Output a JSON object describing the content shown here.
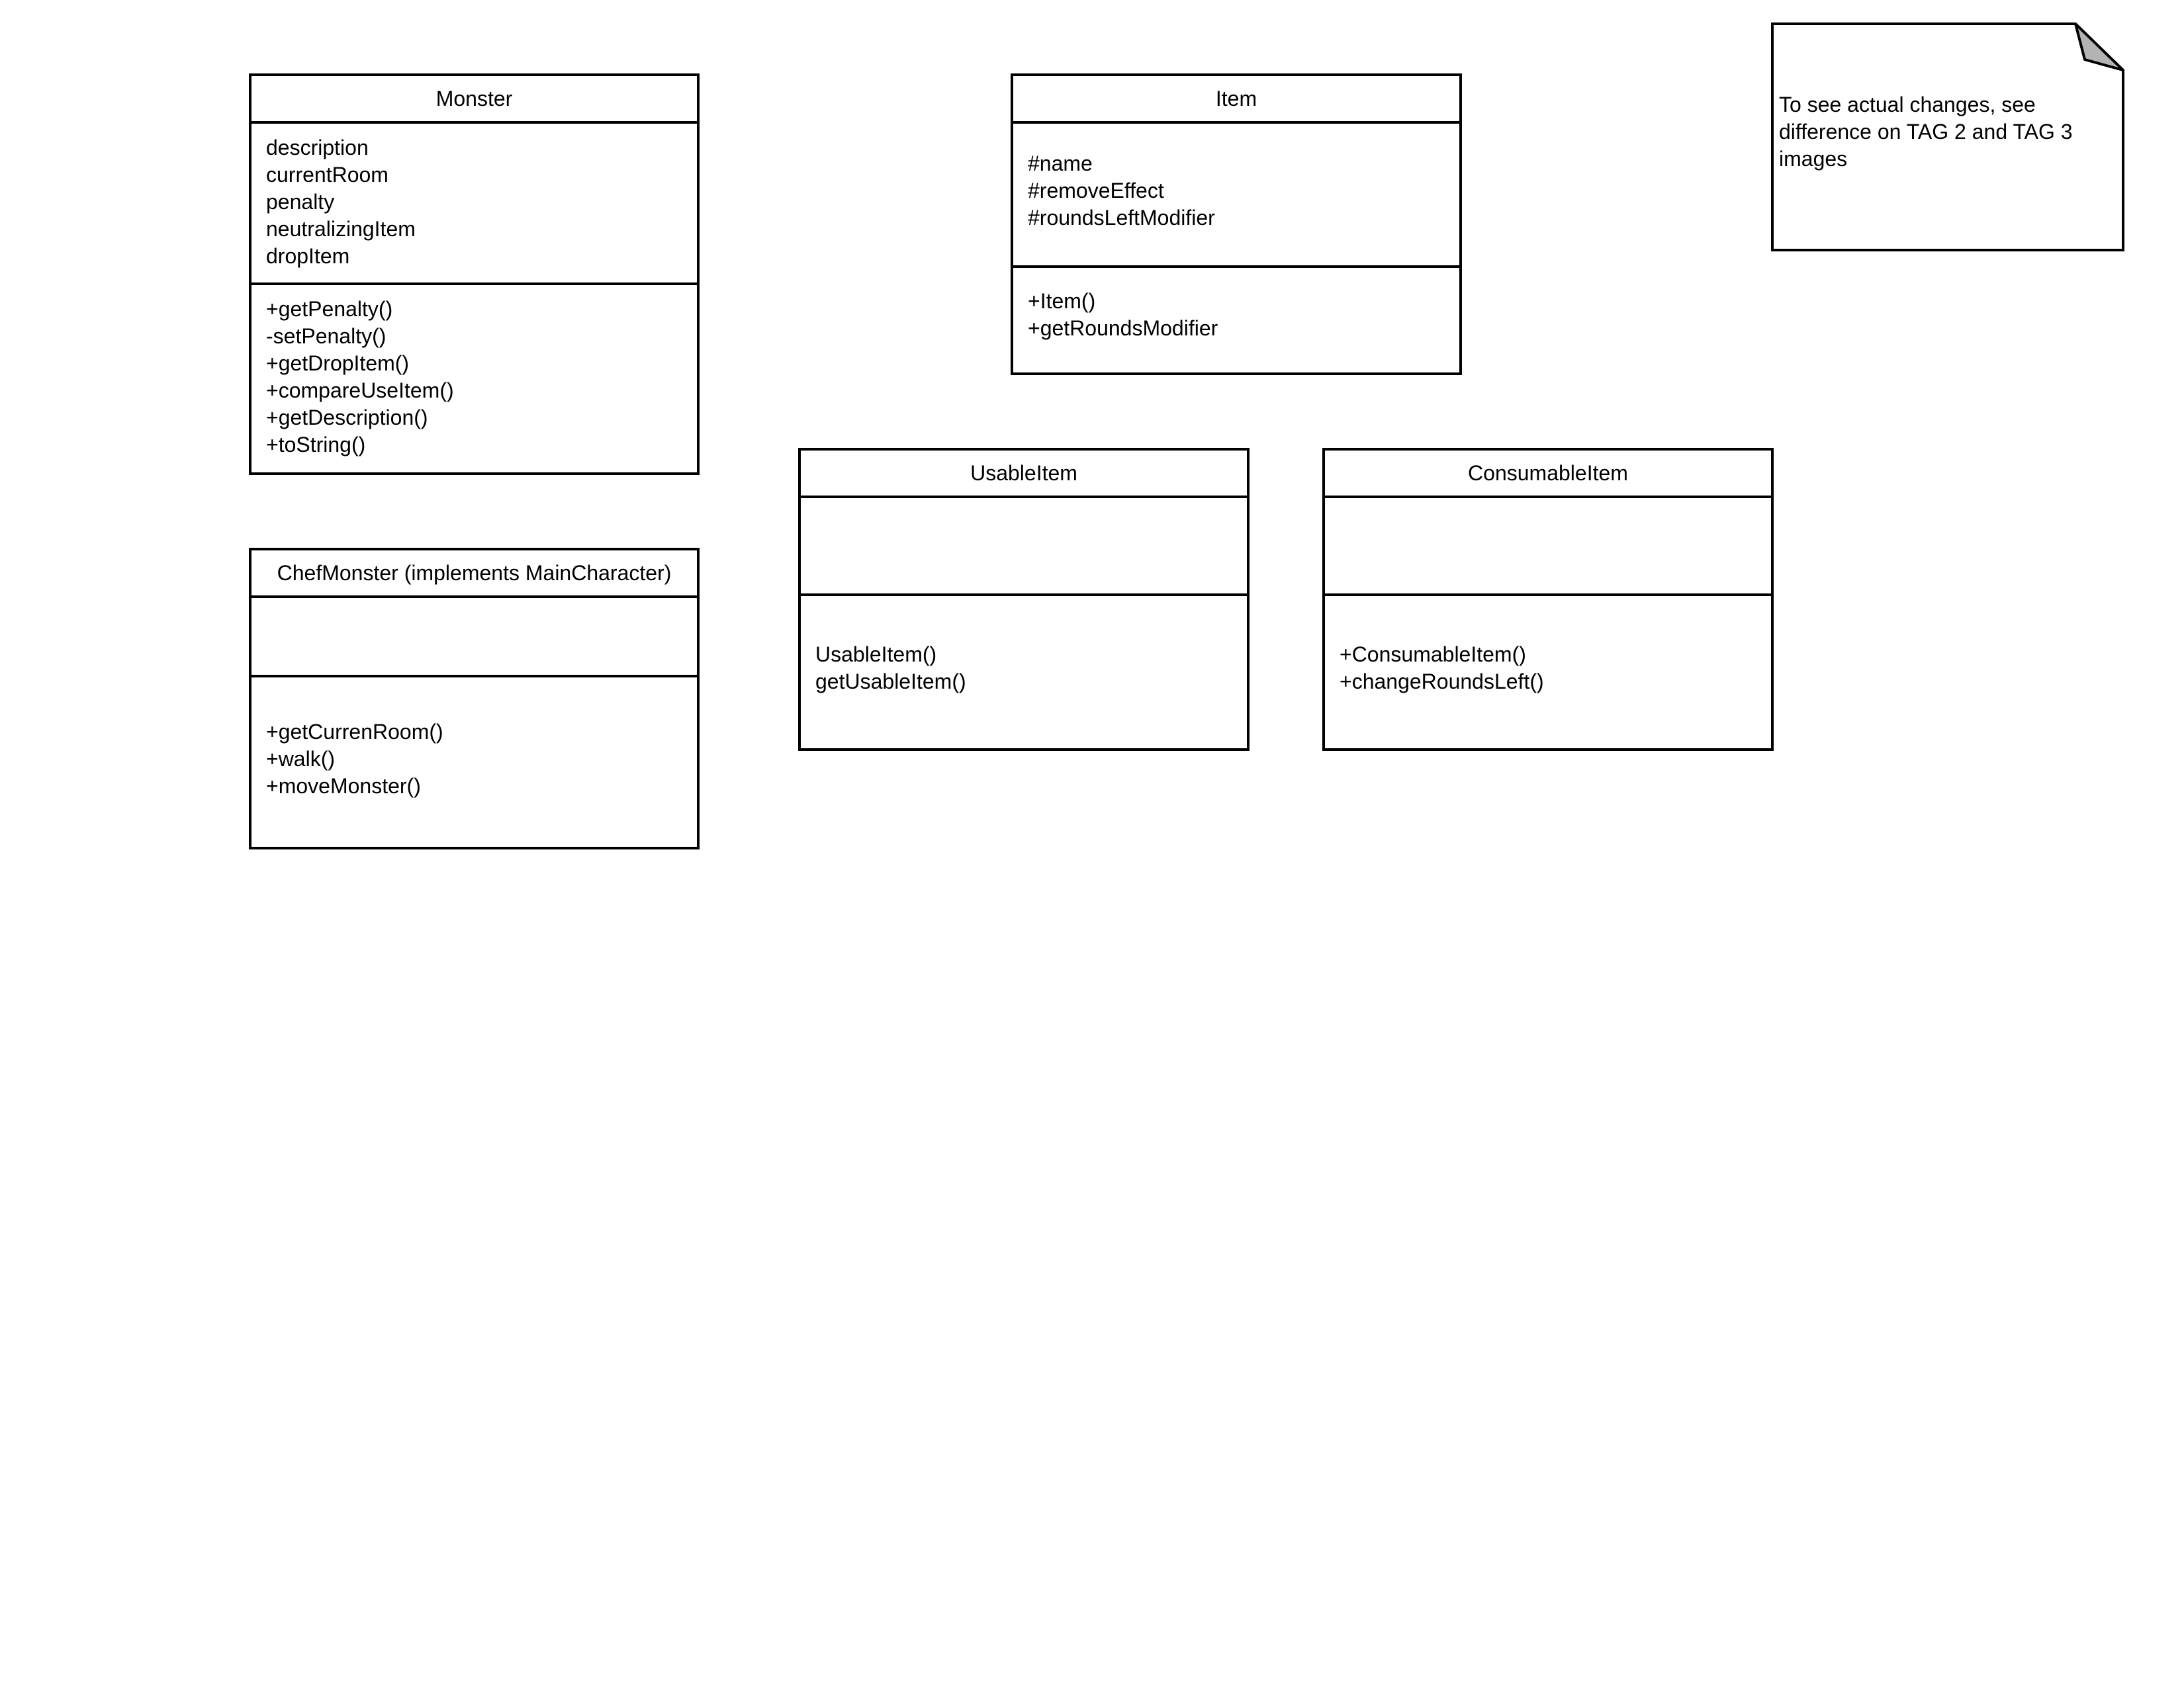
{
  "classes": {
    "monster": {
      "name": "Monster",
      "attributes": [
        "description",
        "currentRoom",
        "penalty",
        "neutralizingItem",
        "dropItem"
      ],
      "methods": [
        "+getPenalty()",
        "-setPenalty()",
        "+getDropItem()",
        "+compareUseItem()",
        "+getDescription()",
        "+toString()"
      ]
    },
    "item": {
      "name": "Item",
      "attributes": [
        "#name",
        "#removeEffect",
        "#roundsLeftModifier"
      ],
      "methods": [
        "+Item()",
        "+getRoundsModifier"
      ]
    },
    "chef_monster": {
      "name": "ChefMonster (implements MainCharacter)",
      "attributes": [],
      "methods": [
        "+getCurrenRoom()",
        "+walk()",
        "+moveMonster()"
      ]
    },
    "usable_item": {
      "name": "UsableItem",
      "attributes": [],
      "methods": [
        "UsableItem()",
        "getUsableItem()"
      ]
    },
    "consumable_item": {
      "name": "ConsumableItem",
      "attributes": [],
      "methods": [
        "+ConsumableItem()",
        "+changeRoundsLeft()"
      ]
    }
  },
  "note": {
    "text": "To see actual changes, see difference on TAG 2 and TAG 3 images"
  },
  "colors": {
    "stroke": "#000000",
    "background": "#ffffff",
    "note_fold": "#b3b3b3"
  }
}
